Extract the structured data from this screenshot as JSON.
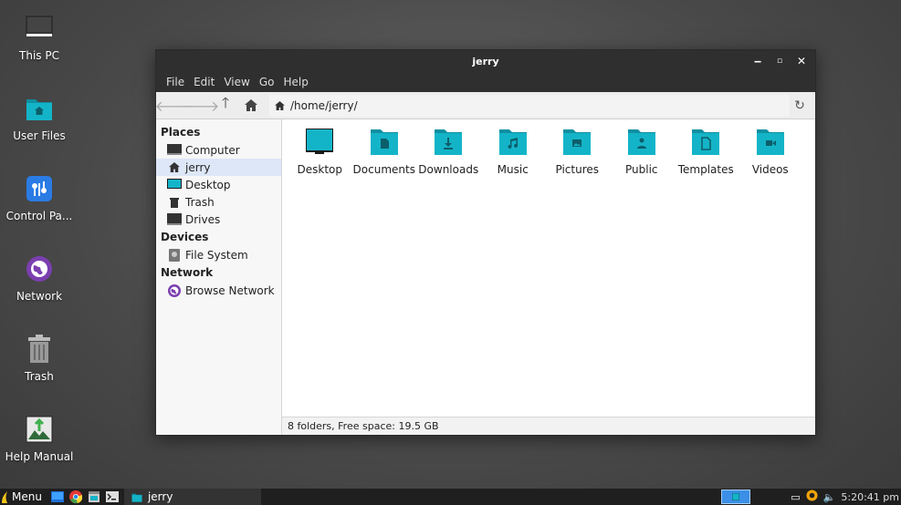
{
  "desktop": {
    "icons": [
      {
        "label": "This PC",
        "icon": "monitor-icon"
      },
      {
        "label": "User Files",
        "icon": "home-folder-icon"
      },
      {
        "label": "Control Pa...",
        "icon": "control-panel-icon"
      },
      {
        "label": "Network",
        "icon": "network-globe-icon"
      },
      {
        "label": "Trash",
        "icon": "trash-icon"
      },
      {
        "label": "Help Manual",
        "icon": "help-manual-icon"
      }
    ]
  },
  "window": {
    "title": "jerry",
    "menu": [
      "File",
      "Edit",
      "View",
      "Go",
      "Help"
    ],
    "address": "/home/jerry/",
    "sidebar": {
      "places_header": "Places",
      "places": [
        {
          "label": "Computer",
          "icon": "monitor-icon"
        },
        {
          "label": "jerry",
          "icon": "home-icon",
          "selected": true
        },
        {
          "label": "Desktop",
          "icon": "desktop-icon"
        },
        {
          "label": "Trash",
          "icon": "trash-icon"
        },
        {
          "label": "Drives",
          "icon": "drive-icon"
        }
      ],
      "devices_header": "Devices",
      "devices": [
        {
          "label": "File System",
          "icon": "disk-icon"
        }
      ],
      "network_header": "Network",
      "network": [
        {
          "label": "Browse Network",
          "icon": "network-globe-icon"
        }
      ]
    },
    "files": [
      {
        "name": "Desktop",
        "icon": "desktop-folder-icon"
      },
      {
        "name": "Documents",
        "icon": "documents-folder-icon"
      },
      {
        "name": "Downloads",
        "icon": "downloads-folder-icon"
      },
      {
        "name": "Music",
        "icon": "music-folder-icon"
      },
      {
        "name": "Pictures",
        "icon": "pictures-folder-icon"
      },
      {
        "name": "Public",
        "icon": "public-folder-icon"
      },
      {
        "name": "Templates",
        "icon": "templates-folder-icon"
      },
      {
        "name": "Videos",
        "icon": "videos-folder-icon"
      }
    ],
    "status": "8 folders, Free space: 19.5 GB"
  },
  "taskbar": {
    "menu_label": "Menu",
    "task_label": "jerry",
    "clock": "5:20:41 pm"
  },
  "colors": {
    "folder": "#14b4c8",
    "folder_dark": "#0e8fa1",
    "selection": "#dde7f7",
    "titlebar": "#2f2f2f"
  }
}
